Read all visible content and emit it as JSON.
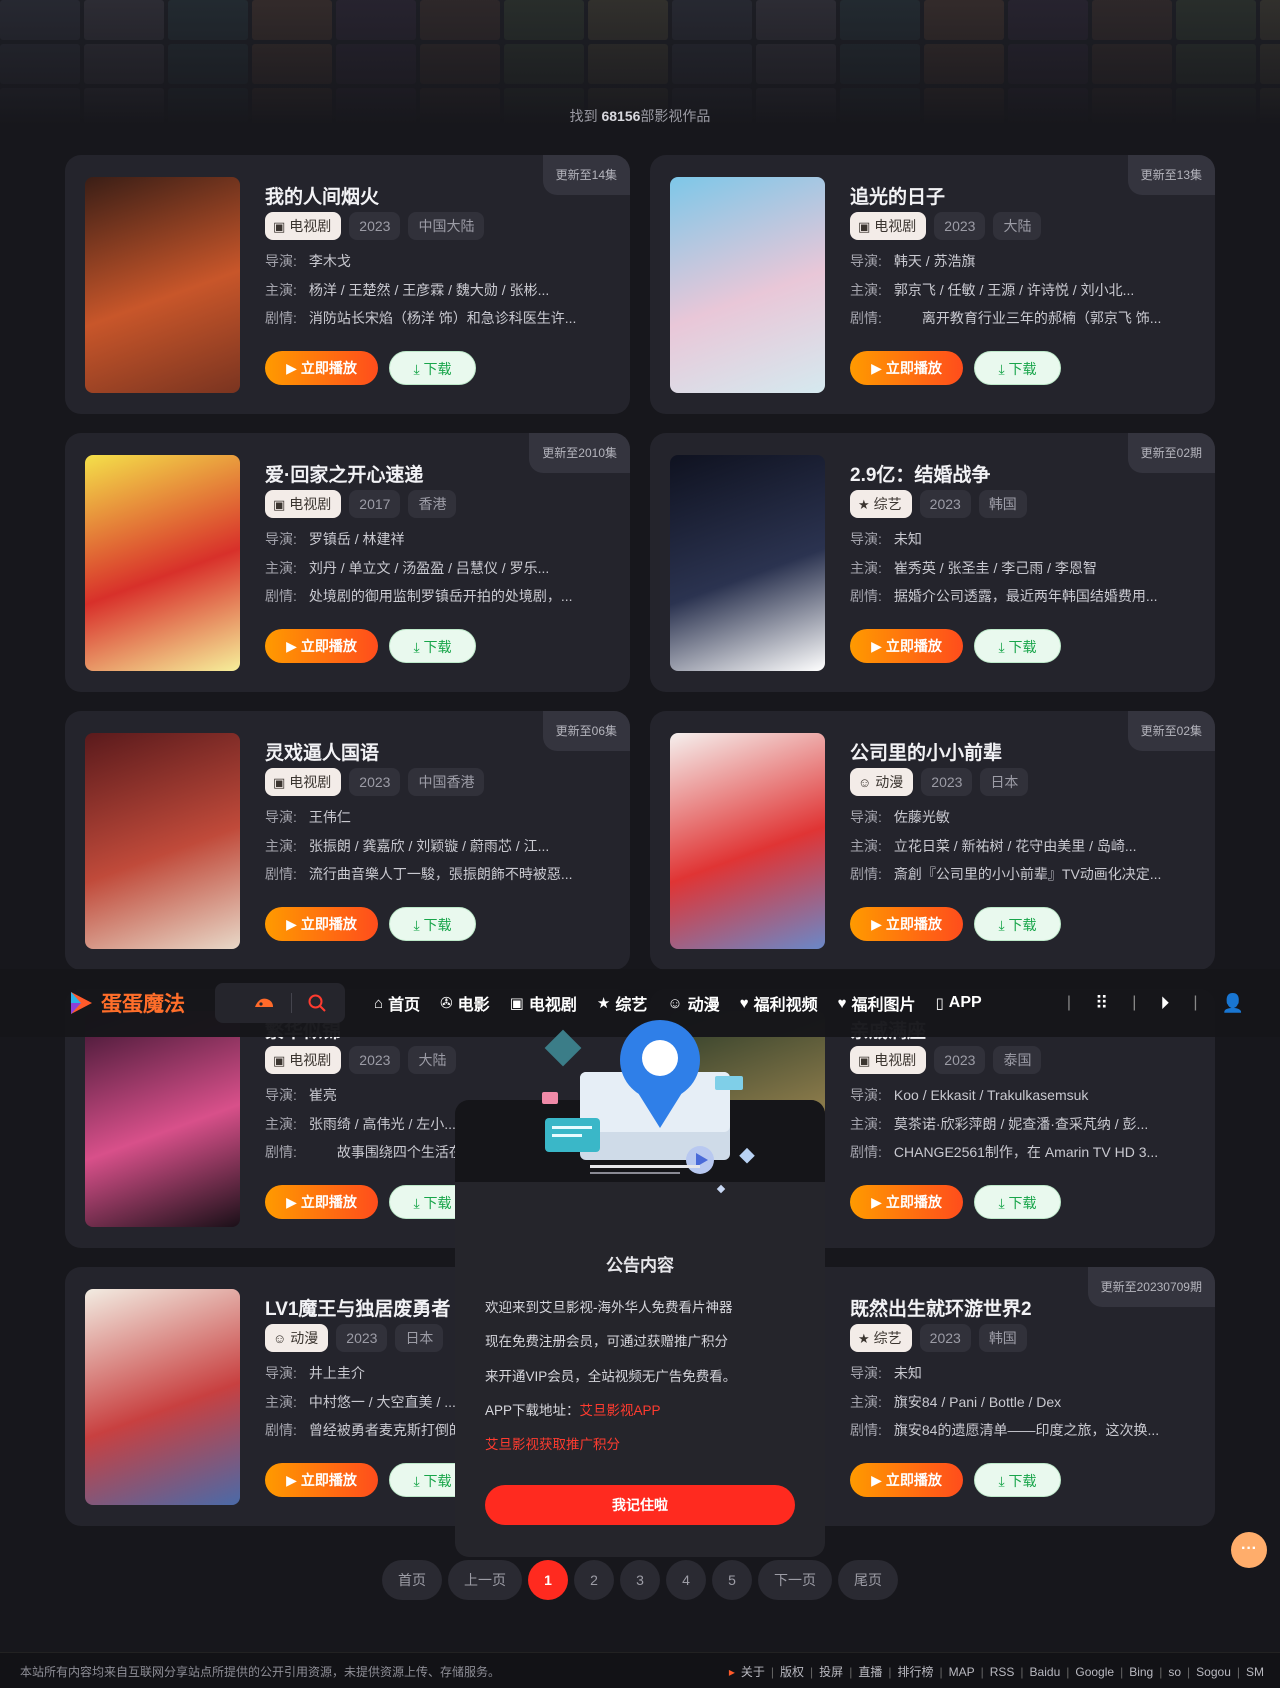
{
  "result_count": {
    "prefix": "找到 ",
    "count": "68156",
    "suffix": "部影视作品"
  },
  "labels": {
    "director": "导演:",
    "actors": "主演:",
    "plot": "剧情:",
    "play": "立即播放",
    "download": "下载"
  },
  "cards": [
    {
      "title": "我的人间烟火",
      "type": "电视剧",
      "type_icon": "tv-icon",
      "year": "2023",
      "region": "中国大陆",
      "badge": "更新至14集",
      "director": "李木戈",
      "actors": "杨洋 / 王楚然 / 王彦霖 / 魏大勋 / 张彬...",
      "plot": "消防站长宋焰（杨洋 饰）和急诊科医生许...",
      "poster_colors": [
        "#3a1e16",
        "#c8562a",
        "#7a3420"
      ]
    },
    {
      "title": "追光的日子",
      "type": "电视剧",
      "type_icon": "tv-icon",
      "year": "2023",
      "region": "大陆",
      "badge": "更新至13集",
      "director": "韩天 / 苏浩旗",
      "actors": "郭京飞 / 任敏 / 王源 / 许诗悦 / 刘小北...",
      "plot": "　　离开教育行业三年的郝楠（郭京飞 饰...",
      "poster_colors": [
        "#7dc7e8",
        "#e9c7d8",
        "#d5e9ef"
      ]
    },
    {
      "title": "爱·回家之开心速递",
      "type": "电视剧",
      "type_icon": "tv-icon",
      "year": "2017",
      "region": "香港",
      "badge": "更新至2010集",
      "director": "罗镇岳 / 林建祥",
      "actors": "刘丹 / 单立文 / 汤盈盈 / 吕慧仪 / 罗乐...",
      "plot": "处境剧的御用监制罗镇岳开拍的处境剧，...",
      "poster_colors": [
        "#f4e04a",
        "#d8302a",
        "#f6ef9a"
      ]
    },
    {
      "title": "2.9亿：结婚战争",
      "type": "综艺",
      "type_icon": "star-icon",
      "year": "2023",
      "region": "韩国",
      "badge": "更新至02期",
      "director": "未知",
      "actors": "崔秀英 / 张圣圭 / 李己雨 / 李恩智",
      "plot": "据婚介公司透露，最近两年韩国结婚费用...",
      "poster_colors": [
        "#0f1220",
        "#2b3350",
        "#ffffff"
      ]
    },
    {
      "title": "灵戏逼人国语",
      "type": "电视剧",
      "type_icon": "tv-icon",
      "year": "2023",
      "region": "中国香港",
      "badge": "更新至06集",
      "director": "王伟仁",
      "actors": "张振朗 / 龚嘉欣 / 刘颖镟 / 蔚雨芯 / 江...",
      "plot": "流行曲音樂人丁一駿，張振朗飾不時被惡...",
      "poster_colors": [
        "#5a1a1c",
        "#c04a3a",
        "#e8d8c8"
      ]
    },
    {
      "title": "公司里的小小前辈",
      "type": "动漫",
      "type_icon": "smile-icon",
      "year": "2023",
      "region": "日本",
      "badge": "更新至02集",
      "director": "佐藤光敏",
      "actors": "立花日菜 / 新祐树 / 花守由美里 / 岛崎...",
      "plot": "斎創『公司里的小小前辈』TV动画化决定...",
      "poster_colors": [
        "#f5f0ee",
        "#e03434",
        "#6a88c8"
      ]
    },
    {
      "title": "繁华似锦",
      "type": "电视剧",
      "type_icon": "tv-icon",
      "year": "2023",
      "region": "大陆",
      "badge": "",
      "director": "崔亮",
      "actors": "张雨绮 / 高伟光 / 左小...",
      "plot": "　　故事围绕四个生活在...",
      "poster_colors": [
        "#3a1430",
        "#d8508a",
        "#1a1018"
      ]
    },
    {
      "title": "亲戚满座",
      "type": "电视剧",
      "type_icon": "tv-icon",
      "year": "2023",
      "region": "泰国",
      "badge": "",
      "director": "Koo / Ekkasit / Trakulkasemsuk",
      "actors": "莫茶诺·欣彩萍朗 / 妮查潘·查采芃纳 / 彭...",
      "plot": "CHANGE2561制作，在 Amarin TV HD 3...",
      "poster_colors": [
        "#2a3a28",
        "#8a7a4a",
        "#1a2418"
      ]
    },
    {
      "title": "LV1魔王与独居废勇者",
      "type": "动漫",
      "type_icon": "smile-icon",
      "year": "2023",
      "region": "日本",
      "badge": "",
      "director": "井上圭介",
      "actors": "中村悠一 / 大空直美 / ...",
      "plot": "曾经被勇者麦克斯打倒的...",
      "poster_colors": [
        "#f2ece2",
        "#c84040",
        "#4a6aa8"
      ]
    },
    {
      "title": "既然出生就环游世界2",
      "type": "综艺",
      "type_icon": "star-icon",
      "year": "2023",
      "region": "韩国",
      "badge": "更新至20230709期",
      "director": "未知",
      "actors": "旗安84 / Pani / Bottle / Dex",
      "plot": "旗安84的遗愿清单——印度之旅，这次换...",
      "poster_colors": [
        "#2a2a32",
        "#3a3a44",
        "#24242c"
      ]
    }
  ],
  "navbar": {
    "logo": "蛋蛋魔法",
    "items": [
      {
        "label": "首页",
        "icon": "home-icon",
        "glyph": "⌂"
      },
      {
        "label": "电影",
        "icon": "film-reel-icon",
        "glyph": "✇"
      },
      {
        "label": "电视剧",
        "icon": "tv-icon",
        "glyph": "▣"
      },
      {
        "label": "综艺",
        "icon": "star-icon",
        "glyph": "★"
      },
      {
        "label": "动漫",
        "icon": "smile-icon",
        "glyph": "☺"
      },
      {
        "label": "福利视频",
        "icon": "heart-icon",
        "glyph": "♥"
      },
      {
        "label": "福利图片",
        "icon": "heart-icon",
        "glyph": "♥"
      },
      {
        "label": "APP",
        "icon": "phone-icon",
        "glyph": "▯"
      }
    ]
  },
  "modal": {
    "title": "公告内容",
    "line1": "欢迎来到艾旦影视-海外华人免费看片神器",
    "line2": "现在免费注册会员，可通过获赠推广积分",
    "line3": "来开通VIP会员，全站视频无广告免费看。",
    "line4_prefix": "APP下载地址：",
    "line4_link": "艾旦影视APP",
    "line5_link": "艾旦影视获取推广积分",
    "button": "我记住啦"
  },
  "pager": {
    "first": "首页",
    "prev": "上一页",
    "pages": [
      "1",
      "2",
      "3",
      "4",
      "5"
    ],
    "current": "1",
    "next": "下一页",
    "last": "尾页"
  },
  "footer": {
    "notice": "本站所有内容均来自互联网分享站点所提供的公开引用资源，未提供资源上传、存储服务。",
    "links": [
      "关于",
      "版权",
      "投屏",
      "直播",
      "排行榜",
      "MAP",
      "RSS",
      "Baidu",
      "Google",
      "Bing",
      "so",
      "Sogou",
      "SM"
    ]
  },
  "colors": {
    "accent": "#ff2a1f",
    "play_gradient_start": "#ff9a00",
    "play_gradient_end": "#ff4d1c",
    "download_text": "#18a54a",
    "logo": "#ff6e2a"
  }
}
